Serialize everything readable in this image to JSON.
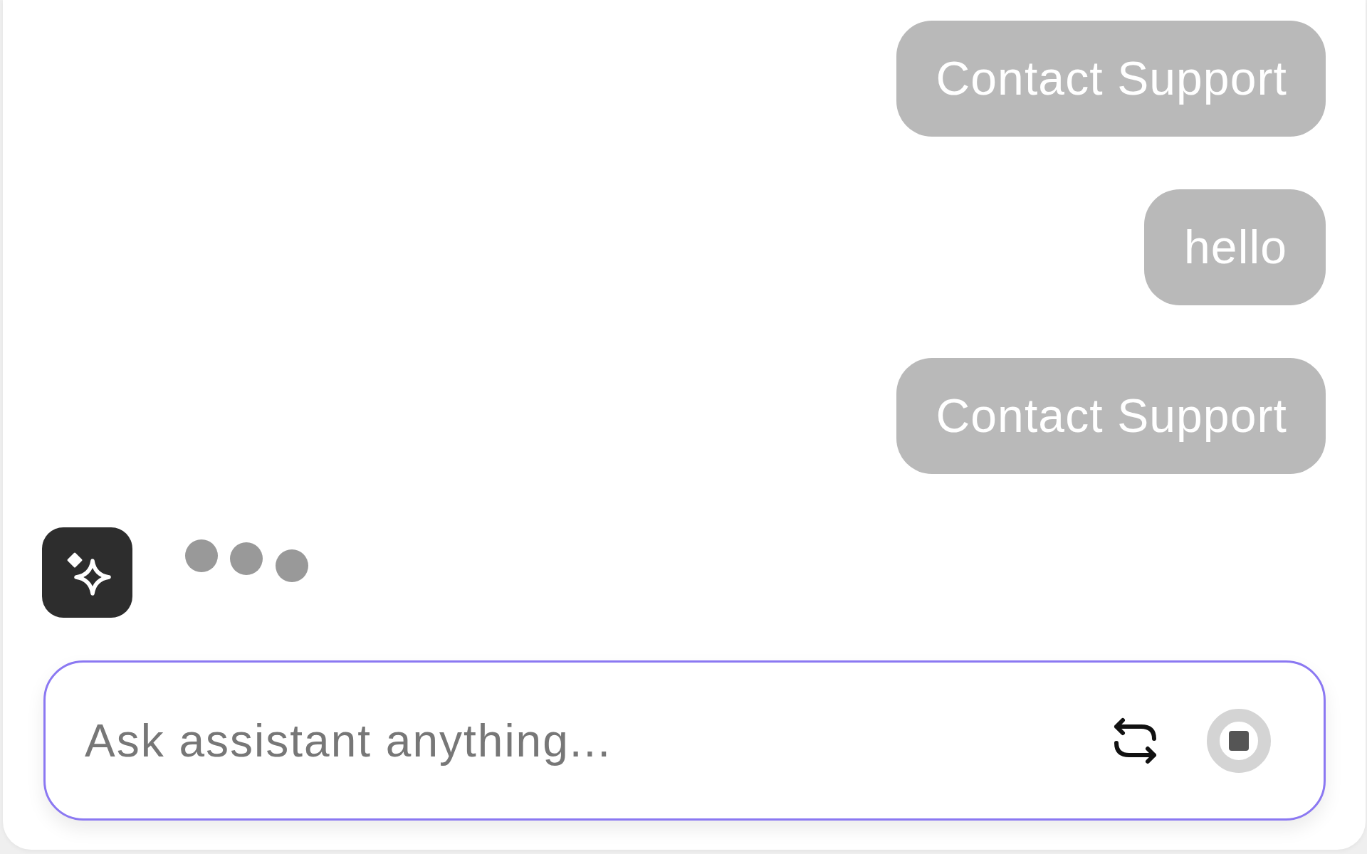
{
  "messages": [
    {
      "kind": "user",
      "text": "Contact Support"
    },
    {
      "kind": "user",
      "text": "hello"
    },
    {
      "kind": "user",
      "text": "Contact Support"
    }
  ],
  "assistant_typing": true,
  "composer": {
    "placeholder": "Ask assistant anything...",
    "focused": true
  }
}
